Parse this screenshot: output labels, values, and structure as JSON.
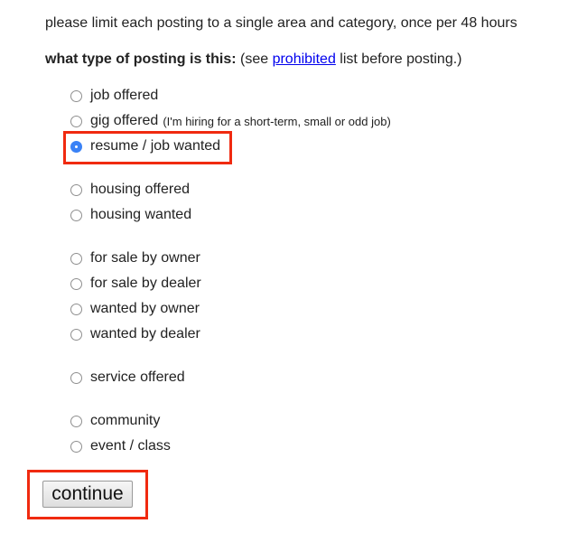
{
  "intro": "please limit each posting to a single area and category, once per 48 hours",
  "question": {
    "label": "what type of posting is this:",
    "pre_link": " (see ",
    "link": "prohibited",
    "post_link": " list before posting.)"
  },
  "options": [
    {
      "label": "job offered",
      "checked": false
    },
    {
      "label": "gig offered",
      "note": "(I'm hiring for a short-term, small or odd job)",
      "checked": false
    },
    {
      "label": "resume / job wanted",
      "checked": true
    },
    {
      "label": "housing offered",
      "checked": false
    },
    {
      "label": "housing wanted",
      "checked": false
    },
    {
      "label": "for sale by owner",
      "checked": false
    },
    {
      "label": "for sale by dealer",
      "checked": false
    },
    {
      "label": "wanted by owner",
      "checked": false
    },
    {
      "label": "wanted by dealer",
      "checked": false
    },
    {
      "label": "service offered",
      "checked": false
    },
    {
      "label": "community",
      "checked": false
    },
    {
      "label": "event / class",
      "checked": false
    }
  ],
  "continue_label": "continue",
  "highlight_color": "#f02a10"
}
